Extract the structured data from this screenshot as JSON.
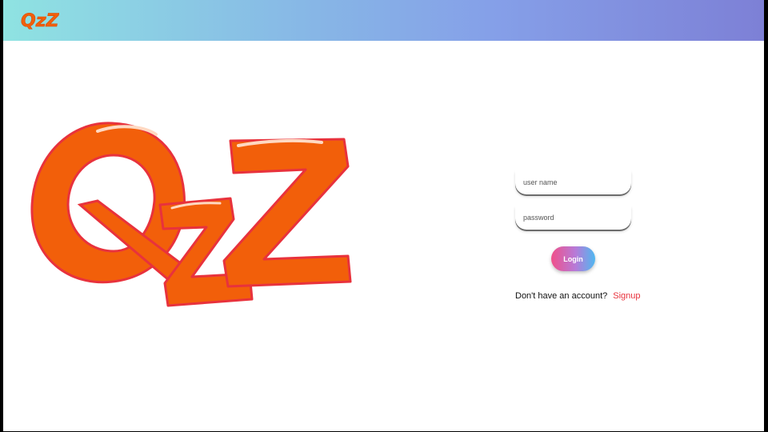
{
  "header": {
    "logo_text": "QzZ"
  },
  "hero": {
    "logo_text": "QzZ"
  },
  "login_form": {
    "username_placeholder": "user name",
    "password_placeholder": "password",
    "login_label": "Login",
    "no_account_text": "Don't have an account?",
    "signup_label": "Signup"
  },
  "colors": {
    "brand_orange": "#f25f0a",
    "signup_red": "#e8323c",
    "header_gradient": [
      "#8fe3e2",
      "#7d80d6"
    ]
  }
}
